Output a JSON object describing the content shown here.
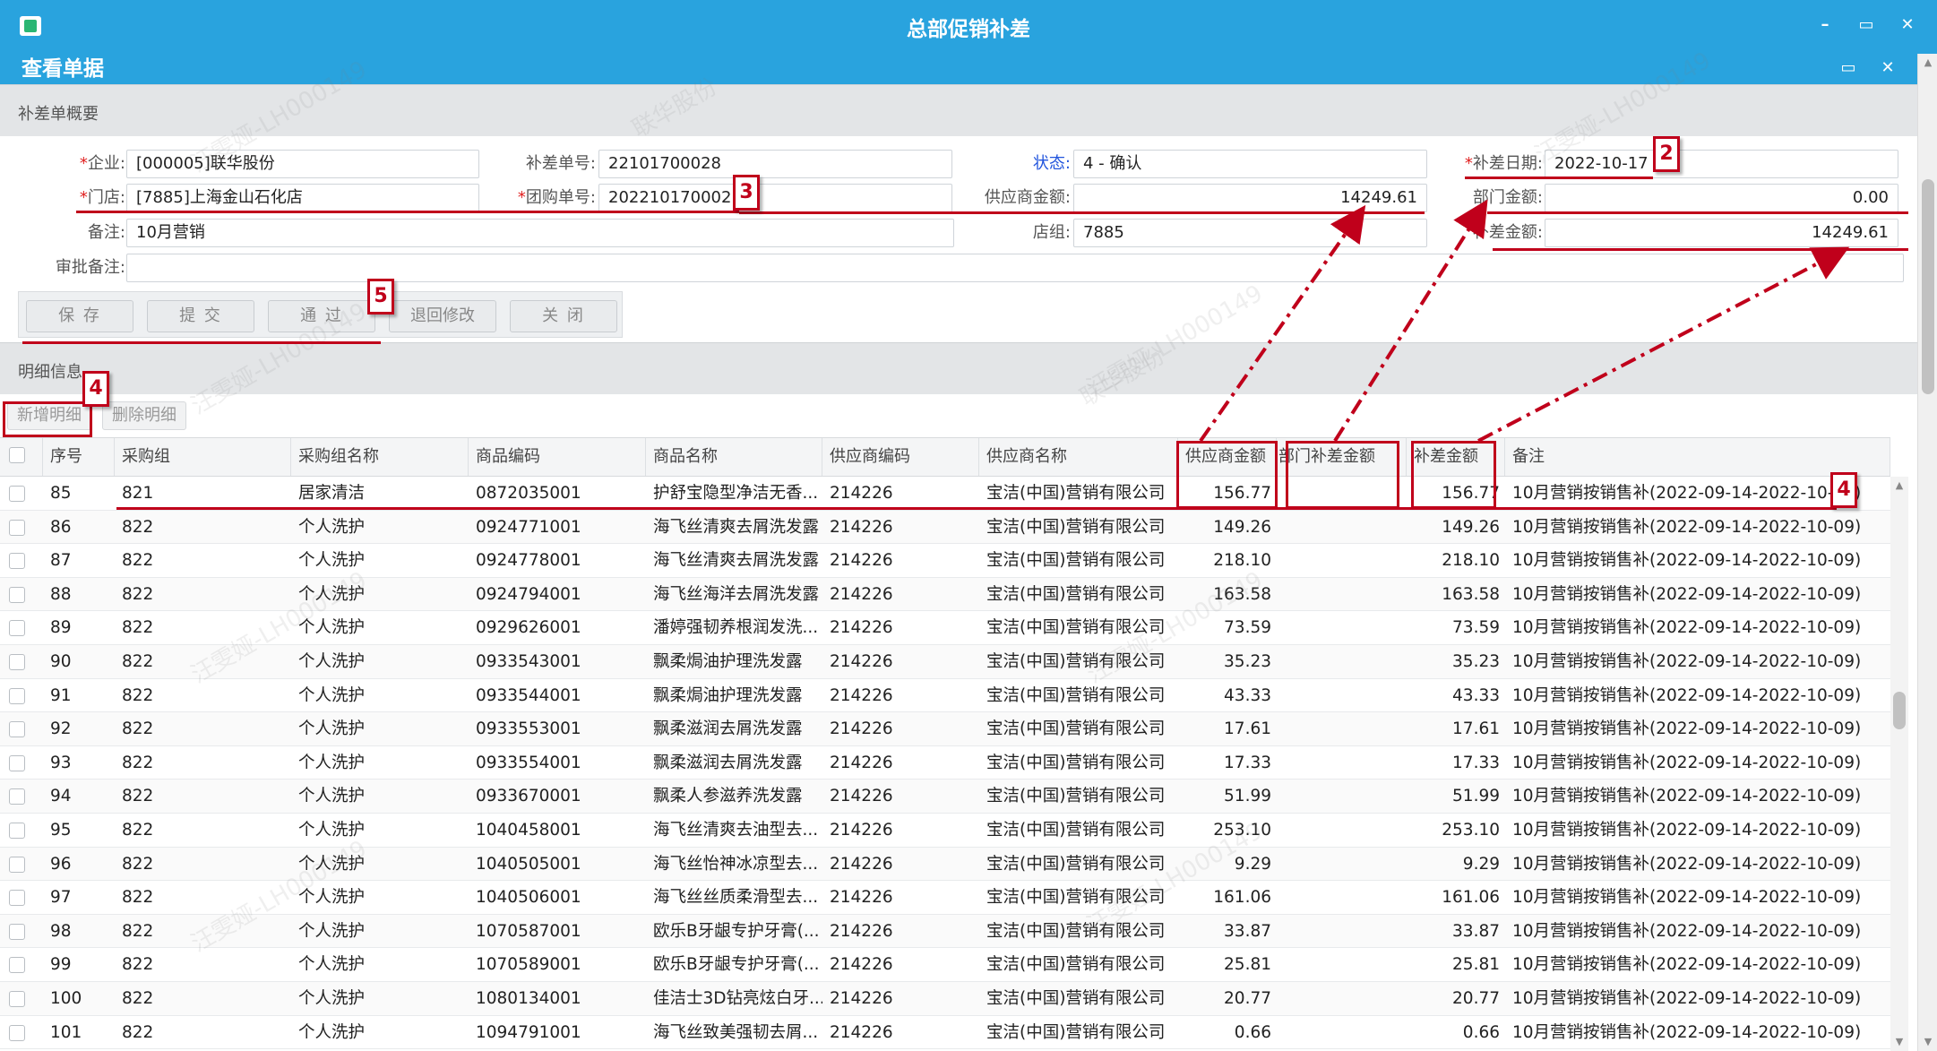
{
  "window": {
    "title": "总部促销补差",
    "controls": [
      "–",
      "▭",
      "✕"
    ]
  },
  "dialog": {
    "title": "查看单据",
    "controls": [
      "▭",
      "✕"
    ]
  },
  "summary": {
    "section_label": "补差单概要",
    "fields": {
      "company": {
        "label": "企业:",
        "value": "[000005]联华股份",
        "required": true
      },
      "store": {
        "label": "门店:",
        "value": "[7885]上海金山石化店",
        "required": true
      },
      "remark": {
        "label": "备注:",
        "value": "10月营销"
      },
      "approval_remark": {
        "label": "审批备注:",
        "value": ""
      },
      "diff_no": {
        "label": "补差单号:",
        "value": "22101700028"
      },
      "group_order_no": {
        "label": "团购单号:",
        "value": "202210170002",
        "required": true
      },
      "status": {
        "label": "状态:",
        "value": "4 - 确认"
      },
      "supplier_amount": {
        "label": "供应商金额:",
        "value": "14249.61"
      },
      "store_group": {
        "label": "店组:",
        "value": "7885"
      },
      "diff_date": {
        "label": "补差日期:",
        "value": "2022-10-17",
        "required": true
      },
      "dept_amount": {
        "label": "部门金额:",
        "value": "0.00"
      },
      "diff_amount": {
        "label": "补差金额:",
        "value": "14249.61"
      }
    },
    "buttons": {
      "save": "保 存",
      "submit": "提 交",
      "pass": "通 过",
      "return": "退回修改",
      "close": "关 闭"
    }
  },
  "detail": {
    "section_label": "明细信息",
    "buttons": {
      "add": "新增明细",
      "delete": "删除明细"
    },
    "columns": [
      "序号",
      "采购组",
      "采购组名称",
      "商品编码",
      "商品名称",
      "供应商编码",
      "供应商名称",
      "供应商金额",
      "部门补差金额",
      "补差金额",
      "备注"
    ],
    "rows": [
      [
        "85",
        "821",
        "居家清洁",
        "0872035001",
        "护舒宝隐型净洁无香...",
        "214226",
        "宝洁(中国)营销有限公司",
        "156.77",
        "",
        "156.77",
        "10月营销按销售补(2022-09-14-2022-10-09)"
      ],
      [
        "86",
        "822",
        "个人洗护",
        "0924771001",
        "海飞丝清爽去屑洗发露",
        "214226",
        "宝洁(中国)营销有限公司",
        "149.26",
        "",
        "149.26",
        "10月营销按销售补(2022-09-14-2022-10-09)"
      ],
      [
        "87",
        "822",
        "个人洗护",
        "0924778001",
        "海飞丝清爽去屑洗发露",
        "214226",
        "宝洁(中国)营销有限公司",
        "218.10",
        "",
        "218.10",
        "10月营销按销售补(2022-09-14-2022-10-09)"
      ],
      [
        "88",
        "822",
        "个人洗护",
        "0924794001",
        "海飞丝海洋去屑洗发露",
        "214226",
        "宝洁(中国)营销有限公司",
        "163.58",
        "",
        "163.58",
        "10月营销按销售补(2022-09-14-2022-10-09)"
      ],
      [
        "89",
        "822",
        "个人洗护",
        "0929626001",
        "潘婷强韧养根润发洗...",
        "214226",
        "宝洁(中国)营销有限公司",
        "73.59",
        "",
        "73.59",
        "10月营销按销售补(2022-09-14-2022-10-09)"
      ],
      [
        "90",
        "822",
        "个人洗护",
        "0933543001",
        "飘柔焗油护理洗发露",
        "214226",
        "宝洁(中国)营销有限公司",
        "35.23",
        "",
        "35.23",
        "10月营销按销售补(2022-09-14-2022-10-09)"
      ],
      [
        "91",
        "822",
        "个人洗护",
        "0933544001",
        "飘柔焗油护理洗发露",
        "214226",
        "宝洁(中国)营销有限公司",
        "43.33",
        "",
        "43.33",
        "10月营销按销售补(2022-09-14-2022-10-09)"
      ],
      [
        "92",
        "822",
        "个人洗护",
        "0933553001",
        "飘柔滋润去屑洗发露",
        "214226",
        "宝洁(中国)营销有限公司",
        "17.61",
        "",
        "17.61",
        "10月营销按销售补(2022-09-14-2022-10-09)"
      ],
      [
        "93",
        "822",
        "个人洗护",
        "0933554001",
        "飘柔滋润去屑洗发露",
        "214226",
        "宝洁(中国)营销有限公司",
        "17.33",
        "",
        "17.33",
        "10月营销按销售补(2022-09-14-2022-10-09)"
      ],
      [
        "94",
        "822",
        "个人洗护",
        "0933670001",
        "飘柔人参滋养洗发露",
        "214226",
        "宝洁(中国)营销有限公司",
        "51.99",
        "",
        "51.99",
        "10月营销按销售补(2022-09-14-2022-10-09)"
      ],
      [
        "95",
        "822",
        "个人洗护",
        "1040458001",
        "海飞丝清爽去油型去...",
        "214226",
        "宝洁(中国)营销有限公司",
        "253.10",
        "",
        "253.10",
        "10月营销按销售补(2022-09-14-2022-10-09)"
      ],
      [
        "96",
        "822",
        "个人洗护",
        "1040505001",
        "海飞丝怡神冰凉型去...",
        "214226",
        "宝洁(中国)营销有限公司",
        "9.29",
        "",
        "9.29",
        "10月营销按销售补(2022-09-14-2022-10-09)"
      ],
      [
        "97",
        "822",
        "个人洗护",
        "1040506001",
        "海飞丝丝质柔滑型去...",
        "214226",
        "宝洁(中国)营销有限公司",
        "161.06",
        "",
        "161.06",
        "10月营销按销售补(2022-09-14-2022-10-09)"
      ],
      [
        "98",
        "822",
        "个人洗护",
        "1070587001",
        "欧乐B牙龈专护牙膏(...",
        "214226",
        "宝洁(中国)营销有限公司",
        "33.87",
        "",
        "33.87",
        "10月营销按销售补(2022-09-14-2022-10-09)"
      ],
      [
        "99",
        "822",
        "个人洗护",
        "1070589001",
        "欧乐B牙龈专护牙膏(...",
        "214226",
        "宝洁(中国)营销有限公司",
        "25.81",
        "",
        "25.81",
        "10月营销按销售补(2022-09-14-2022-10-09)"
      ],
      [
        "100",
        "822",
        "个人洗护",
        "1080134001",
        "佳洁士3D钻亮炫白牙...",
        "214226",
        "宝洁(中国)营销有限公司",
        "20.77",
        "",
        "20.77",
        "10月营销按销售补(2022-09-14-2022-10-09)"
      ],
      [
        "101",
        "822",
        "个人洗护",
        "1094791001",
        "海飞丝致美强韧去屑...",
        "214226",
        "宝洁(中国)营销有限公司",
        "0.66",
        "",
        "0.66",
        "10月营销按销售补(2022-09-14-2022-10-09)"
      ]
    ]
  },
  "annotations": {
    "markers": [
      "2",
      "3",
      "4",
      "4",
      "5"
    ],
    "color": "#c0001b"
  },
  "watermark": {
    "lines": [
      "汪雯娅-LH000149",
      "联华股份"
    ]
  },
  "colors": {
    "titlebar": "#29a3de",
    "annotation": "#c0001b",
    "required": "#e02020"
  }
}
